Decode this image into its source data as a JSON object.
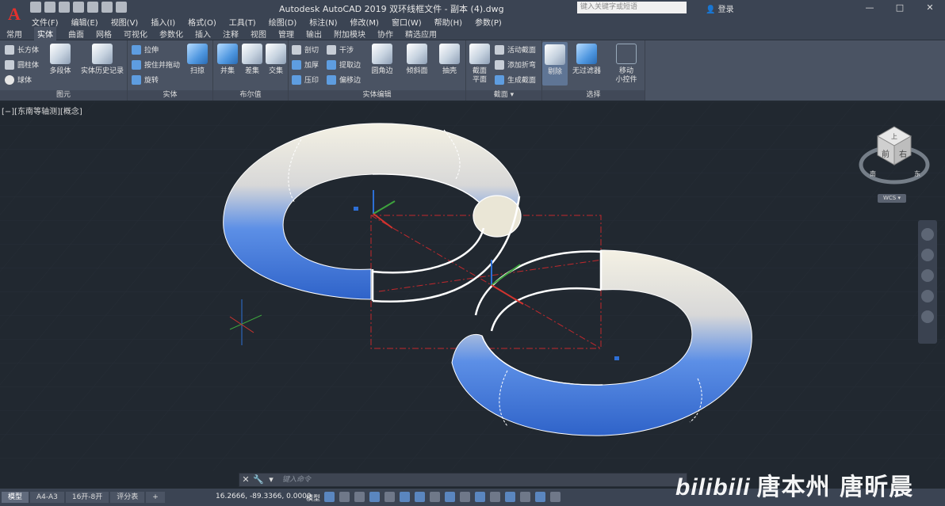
{
  "app": {
    "logo": "A",
    "title": "Autodesk AutoCAD 2019    双环线框文件 - 副本 (4).dwg",
    "search_placeholder": "键入关键字或短语",
    "login": "登录",
    "window_buttons": [
      "—",
      "□",
      "✕"
    ]
  },
  "menu": [
    "文件(F)",
    "编辑(E)",
    "视图(V)",
    "插入(I)",
    "格式(O)",
    "工具(T)",
    "绘图(D)",
    "标注(N)",
    "修改(M)",
    "窗口(W)",
    "帮助(H)",
    "参数(P)"
  ],
  "ribbon_tabs": [
    "常用",
    "实体",
    "曲面",
    "网格",
    "可视化",
    "参数化",
    "插入",
    "注释",
    "视图",
    "管理",
    "输出",
    "附加模块",
    "协作",
    "精选应用"
  ],
  "ribbon_active_tab": "实体",
  "ribbon": {
    "primitive": {
      "title": "图元",
      "box": "长方体",
      "cylinder": "圆柱体",
      "sphere": "球体",
      "polysolid": "多段体",
      "history": "实体历史记录"
    },
    "solid": {
      "title": "实体",
      "extrude": "拉伸",
      "presspull": "按住并拖动",
      "revolve": "旋转",
      "sweep": "扫掠"
    },
    "boolean": {
      "title": "布尔值",
      "union": "并集",
      "subtract": "差集",
      "intersect": "交集"
    },
    "solid_edit": {
      "title": "实体编辑",
      "slice": "剖切",
      "thicken": "加厚",
      "imprint": "压印",
      "interfere": "干涉",
      "extract_edges": "提取边",
      "offset_edge": "偏移边",
      "fillet_edge": "圆角边",
      "chamfer_edge": "倾斜面",
      "shell": "抽壳"
    },
    "section": {
      "title": "截面",
      "plane_label1": "截面",
      "plane_label2": "平面",
      "live_section": "活动截面",
      "add_jog": "添加折弯",
      "generate_section": "生成截面"
    },
    "selection": {
      "title": "选择",
      "culling": "剔除",
      "no_filter": "无过滤器",
      "gizmo_label1": "移动",
      "gizmo_label2": "小控件"
    }
  },
  "viewport": {
    "label": "[−][东南等轴测][概念]",
    "viewcube_top": "上",
    "viewcube_front": "前",
    "viewcube_right": "右",
    "compass_s": "南",
    "compass_e": "东",
    "wcs": "WCS ▾"
  },
  "command_line": {
    "placeholder": "键入命令"
  },
  "status": {
    "layout_tabs": [
      "模型",
      "A4-A3",
      "16开-8开",
      "评分表"
    ],
    "active_layout": "模型",
    "add_tab": "+",
    "coords": "16.2666, -89.3366, 0.0000",
    "space": "模型"
  },
  "watermark": {
    "logo": "bilibili",
    "text": "唐本州 唐昕晨"
  },
  "colors": {
    "torus": "#4a7fe0",
    "torus_hilite": "#f3f1e6",
    "bg": "#212830",
    "red": "#c2282d"
  }
}
